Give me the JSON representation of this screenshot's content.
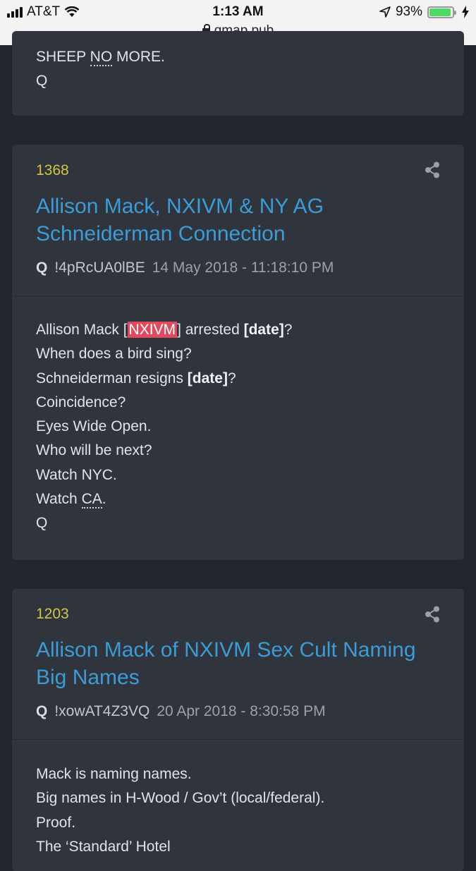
{
  "status_bar": {
    "carrier": "AT&T",
    "time": "1:13 AM",
    "battery": "93%",
    "url": "qmap.pub"
  },
  "top_card": {
    "line_prefix": "SHEEP ",
    "line_dotted": "NO",
    "line_suffix": " MORE.",
    "signature": "Q"
  },
  "posts": [
    {
      "number": "1368",
      "title_line1": "Allison Mack, NXIVM & NY AG",
      "title_line2": "Schneiderman Connection",
      "author": "Q",
      "tripcode": "!4pRcUA0lBE",
      "date": "14 May 2018 - 11:18:10 PM",
      "lines": {
        "l1_a": "Allison Mack [",
        "l1_hl": "NXIVM",
        "l1_b": "] arrested ",
        "l1_c": "[date]",
        "l1_d": "?",
        "l2": "When does a bird sing?",
        "l3_a": "Schneiderman resigns ",
        "l3_b": "[date]",
        "l3_c": "?",
        "l4": "Coincidence?",
        "l5": "Eyes Wide Open.",
        "l6": "Who will be next?",
        "l7": "Watch NYC.",
        "l8_a": "Watch ",
        "l8_b": "CA",
        "l8_c": ".",
        "l9": "Q"
      }
    },
    {
      "number": "1203",
      "title_line1": "Allison Mack of NXIVM Sex Cult Naming",
      "title_line2": "Big Names",
      "author": "Q",
      "tripcode": "!xowAT4Z3VQ",
      "date": "20 Apr 2018 - 8:30:58 PM",
      "lines": {
        "l1": "Mack is naming names.",
        "l2": "Big names in H-Wood / Gov’t (local/federal).",
        "l3": "Proof.",
        "l4": "The ‘Standard’ Hotel"
      }
    }
  ],
  "colors": {
    "page_bg": "#22262e",
    "card_bg": "#30343d",
    "post_number": "#d5c444",
    "title_link": "#3d9bd6",
    "highlight": "#e04a5f"
  },
  "icons": [
    "share-icon",
    "lock-icon",
    "wifi-icon",
    "location-arrow-icon",
    "battery-icon",
    "charging-bolt-icon"
  ]
}
